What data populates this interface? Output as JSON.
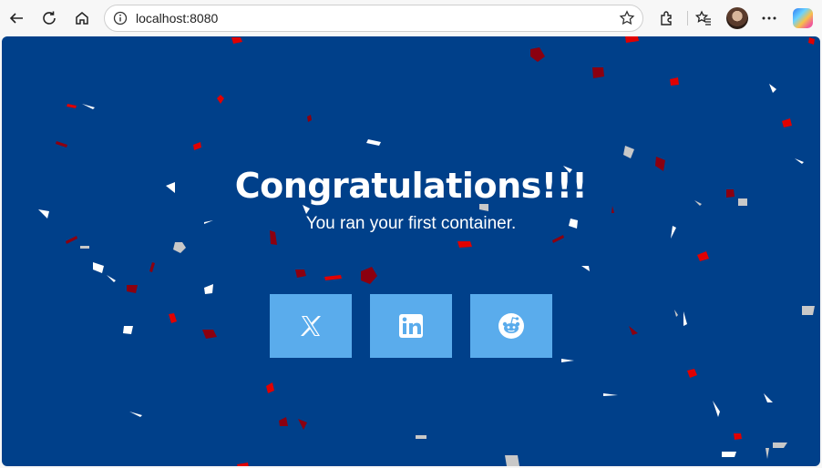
{
  "browser": {
    "url": "localhost:8080",
    "icons": {
      "back": "back-arrow-icon",
      "refresh": "refresh-icon",
      "home": "home-icon",
      "site_info": "info-icon",
      "favorite": "star-icon",
      "extensions": "puzzle-icon",
      "favorites_list": "favorites-icon",
      "profile": "avatar",
      "more": "more-icon",
      "copilot": "copilot-icon"
    }
  },
  "page": {
    "background_color": "#00408a",
    "title": "Congratulations!!!",
    "subtitle": "You ran your first container.",
    "social_buttons": [
      {
        "name": "x-share",
        "icon": "x-logo-icon",
        "color": "#5aacec"
      },
      {
        "name": "linkedin-share",
        "icon": "linkedin-logo-icon",
        "color": "#5aacec"
      },
      {
        "name": "reddit-share",
        "icon": "reddit-logo-icon",
        "color": "#5aacec"
      }
    ],
    "confetti_colors": [
      "#e00000",
      "#8b0010",
      "#ffffff",
      "#c8c8c8"
    ]
  }
}
